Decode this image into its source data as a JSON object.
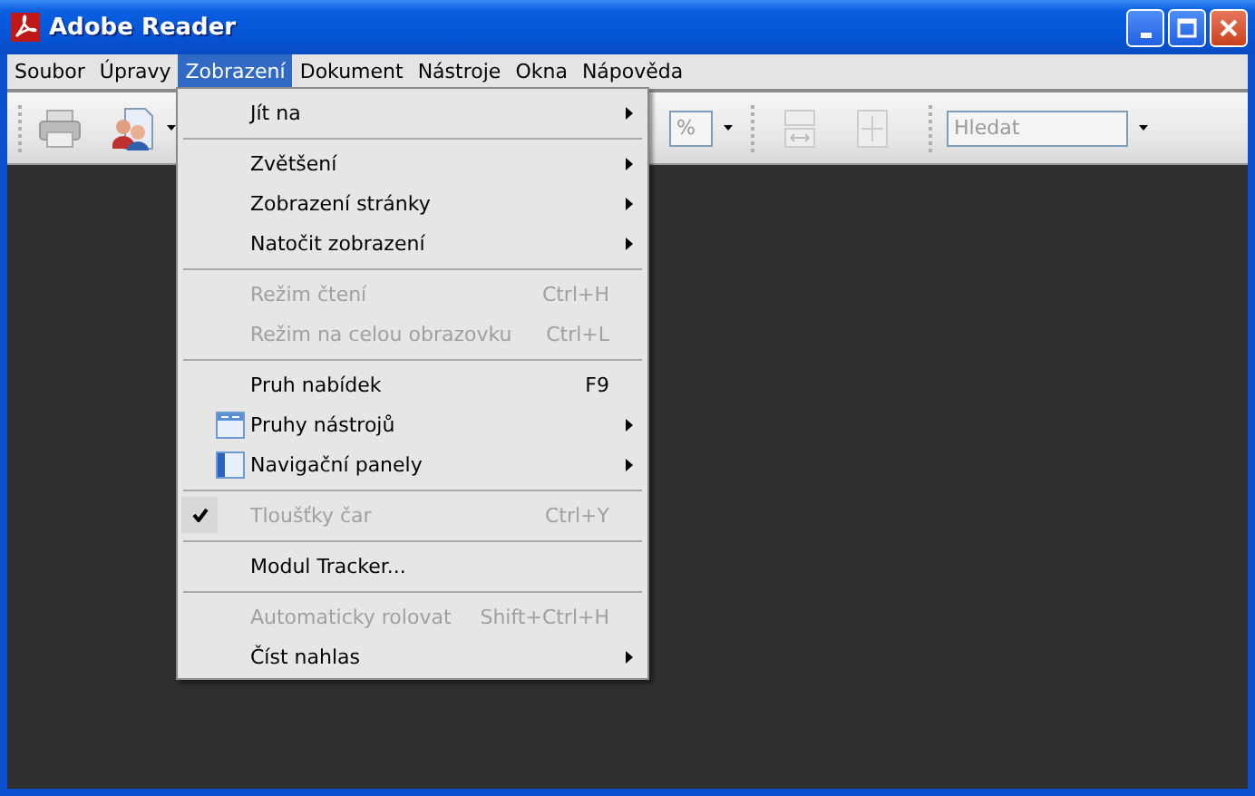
{
  "window": {
    "title": "Adobe Reader"
  },
  "menubar": [
    {
      "label": "Soubor",
      "selected": false
    },
    {
      "label": "Úpravy",
      "selected": false
    },
    {
      "label": "Zobrazení",
      "selected": true
    },
    {
      "label": "Dokument",
      "selected": false
    },
    {
      "label": "Nástroje",
      "selected": false
    },
    {
      "label": "Okna",
      "selected": false
    },
    {
      "label": "Nápověda",
      "selected": false
    }
  ],
  "toolbar": {
    "zoom_field": {
      "value": "%"
    },
    "search_field": {
      "placeholder": "Hledat"
    }
  },
  "menu": [
    {
      "kind": "item",
      "label": "Jít na",
      "submenu": true,
      "disabled": false,
      "checked": false
    },
    {
      "kind": "separator"
    },
    {
      "kind": "item",
      "label": "Zvětšení",
      "submenu": true,
      "disabled": false,
      "checked": false
    },
    {
      "kind": "item",
      "label": "Zobrazení stránky",
      "submenu": true,
      "disabled": false,
      "checked": false
    },
    {
      "kind": "item",
      "label": "Natočit zobrazení",
      "submenu": true,
      "disabled": false,
      "checked": false
    },
    {
      "kind": "separator"
    },
    {
      "kind": "item",
      "label": "Režim čtení",
      "shortcut": "Ctrl+H",
      "submenu": false,
      "disabled": true,
      "checked": false
    },
    {
      "kind": "item",
      "label": "Režim na celou obrazovku",
      "shortcut": "Ctrl+L",
      "submenu": false,
      "disabled": true,
      "checked": false
    },
    {
      "kind": "separator"
    },
    {
      "kind": "item",
      "label": "Pruh nabídek",
      "shortcut": "F9",
      "submenu": false,
      "disabled": false,
      "checked": false
    },
    {
      "kind": "toolbar_item",
      "label": "Pruhy nástrojů",
      "submenu": true,
      "disabled": false,
      "checked": false
    },
    {
      "kind": "panel_item",
      "label": "Navigační panely",
      "submenu": true,
      "disabled": false,
      "checked": false
    },
    {
      "kind": "separator"
    },
    {
      "kind": "item",
      "label": "Tloušťky čar",
      "shortcut": "Ctrl+Y",
      "submenu": false,
      "disabled": true,
      "checked": true
    },
    {
      "kind": "separator"
    },
    {
      "kind": "item",
      "label": "Modul Tracker...",
      "submenu": false,
      "disabled": false,
      "checked": false
    },
    {
      "kind": "separator"
    },
    {
      "kind": "item",
      "label": "Automaticky rolovat",
      "shortcut": "Shift+Ctrl+H",
      "submenu": false,
      "disabled": true,
      "checked": false
    },
    {
      "kind": "item",
      "label": "Číst nahlas",
      "submenu": true,
      "disabled": false,
      "checked": false
    }
  ]
}
